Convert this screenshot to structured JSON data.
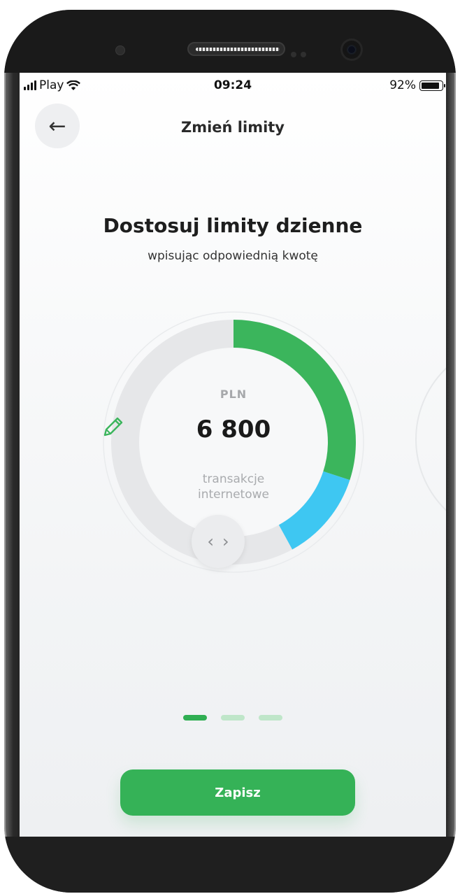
{
  "status_bar": {
    "carrier": "Play",
    "time": "09:24",
    "battery": "92%",
    "battery_level": 0.92,
    "icons": [
      "signal-icon",
      "wifi-icon",
      "battery-icon"
    ]
  },
  "header": {
    "title": "Zmień limity",
    "back_icon": "arrow-left-icon"
  },
  "content": {
    "title": "Dostosuj limity dzienne",
    "subtitle": "wpisując odpowiednią kwotę"
  },
  "limit_gauge": {
    "currency": "PLN",
    "amount": "6 800",
    "label_line1": "transakcje",
    "label_line2": "internetowe",
    "edit_icon": "pencil-icon",
    "handle_icon": "chevron-left-right-icon",
    "green_share": 0.3,
    "blue_share": 0.12,
    "colors": {
      "green": "#3bb55c",
      "green_light": "#6ccf6a",
      "blue": "#3ec7f2",
      "track": "#e6e7e9"
    }
  },
  "pager": {
    "pages": 3,
    "active_index": 0
  },
  "actions": {
    "save_label": "Zapisz"
  },
  "colors": {
    "accent": "#35b257"
  }
}
